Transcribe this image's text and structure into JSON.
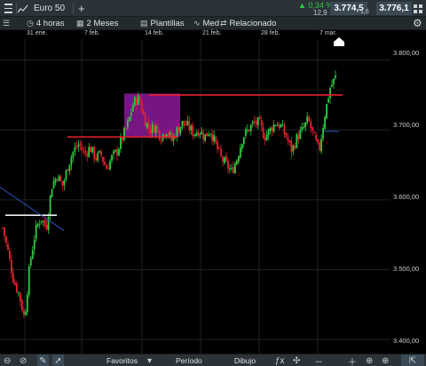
{
  "header": {
    "symbol": "Euro 50",
    "add_tab": "+",
    "change_pct": "▲ 0,34 %",
    "change_abs": "12,9",
    "sell_price": "3.774,5",
    "spread": "1,6",
    "buy_price": "3.776,1",
    "icons": {
      "menu": "menu-icon",
      "chart": "line-chart-icon",
      "layout": "grid-layout-icon"
    }
  },
  "toolbar": {
    "interval": "4 horas",
    "range": "2 Meses",
    "templates": "Plantillas",
    "indicator": "Med",
    "related": "Relacionado",
    "settings_icon": "⚙"
  },
  "x_axis": {
    "labels": [
      "31 ene.",
      "7 feb.",
      "14 feb.",
      "21 feb.",
      "28 feb.",
      "7 mar."
    ]
  },
  "price_axis": {
    "labels": [
      "3.800,00",
      "3.700,00",
      "3.600,00",
      "3.500,00",
      "3.400,00"
    ]
  },
  "bottom_bar": {
    "favorites": "Favoritos",
    "period": "Período",
    "drawing": "Dibujo",
    "icons": [
      "circle-slash-icon",
      "pencil-icon",
      "cursor-icon",
      "zoom-in-icon",
      "zoom-out-icon",
      "crosshair-icon",
      "fx-icon",
      "move-icon",
      "zoom-minus-icon",
      "zoom-plus-icon",
      "expand-icon"
    ]
  },
  "chart_data": {
    "type": "candlestick",
    "instrument": "Euro 50",
    "interval": "4 horas",
    "ylim": [
      3380,
      3830
    ],
    "y_ticks": [
      3800,
      3700,
      3600,
      3500,
      3400
    ],
    "x_ticks": [
      "31 ene.",
      "7 feb.",
      "14 feb.",
      "21 feb.",
      "28 feb.",
      "7 mar."
    ],
    "up_color": "#2ecc40",
    "down_color": "#e8212e",
    "close_path": [
      3560,
      3525,
      3485,
      3465,
      3430,
      3510,
      3555,
      3575,
      3560,
      3620,
      3635,
      3620,
      3650,
      3670,
      3680,
      3665,
      3675,
      3660,
      3665,
      3645,
      3660,
      3670,
      3690,
      3710,
      3740,
      3745,
      3715,
      3700,
      3705,
      3690,
      3700,
      3685,
      3700,
      3710,
      3705,
      3695,
      3700,
      3690,
      3700,
      3680,
      3660,
      3650,
      3640,
      3660,
      3690,
      3700,
      3710,
      3710,
      3690,
      3700,
      3710,
      3705,
      3690,
      3670,
      3690,
      3700,
      3715,
      3690,
      3670,
      3720,
      3760,
      3775
    ],
    "annotations": [
      {
        "type": "hline",
        "price": 3578,
        "color": "#ffffff"
      },
      {
        "type": "hline",
        "price": 3690,
        "color": "#e8212e"
      },
      {
        "type": "hline",
        "price": 3750,
        "color": "#e8212e"
      },
      {
        "type": "hline",
        "price": 3698,
        "color": "#3050c0"
      },
      {
        "type": "rect",
        "price_range": [
          3690,
          3752
        ],
        "color": "#8c1a9a"
      },
      {
        "type": "trendline",
        "color": "#3050c0"
      }
    ]
  }
}
